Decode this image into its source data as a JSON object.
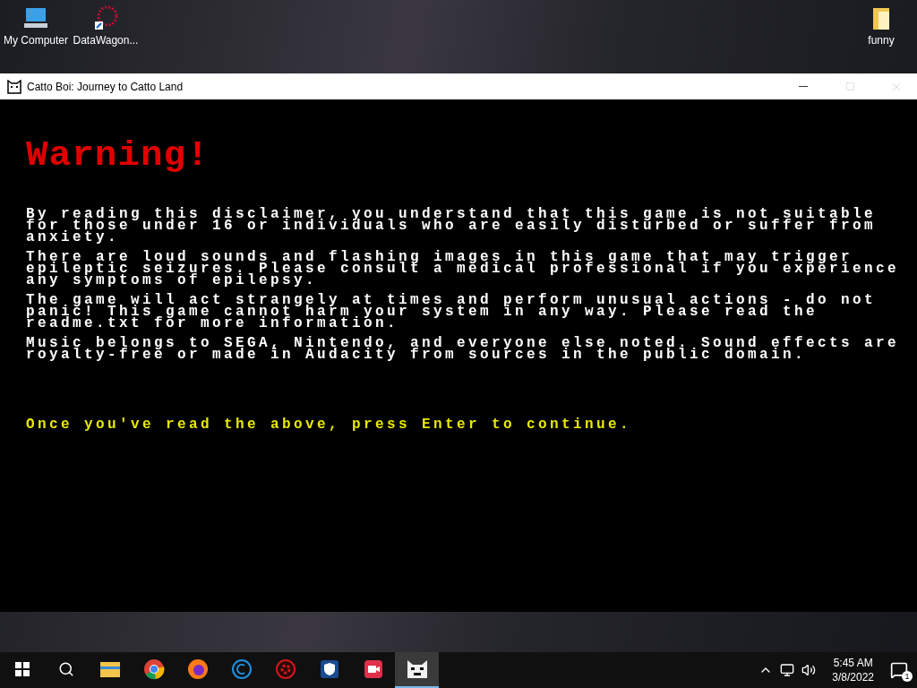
{
  "desktop_icons": [
    {
      "kind": "computer",
      "label": "My Computer"
    },
    {
      "kind": "shortcut",
      "label": "DataWagon..."
    },
    {
      "kind": "folder",
      "label": "funny"
    }
  ],
  "window": {
    "title": "Catto Boi: Journey to Catto Land"
  },
  "game": {
    "heading": "Warning!",
    "paragraphs": [
      "By reading this disclaimer, you understand that this game is not suitable for those under 16 or individuals who are easily disturbed or suffer from anxiety.",
      "There are loud sounds and flashing images in this game that may trigger epileptic seizures. Please consult a medical professional if you experience any symptoms of epilepsy.",
      "The game will act strangely at times and perform unusual actions - do not panic! This game cannot harm your system in any way. Please read the readme.txt for more information.",
      "Music belongs to SEGA, Nintendo, and everyone else noted. Sound effects are royalty-free or made in Audacity from sources in the public domain."
    ],
    "prompt": "Once you've read the above, press Enter to continue."
  },
  "taskbar": {
    "apps": [
      {
        "kind": "folder",
        "selected": false
      },
      {
        "kind": "chrome",
        "selected": false
      },
      {
        "kind": "firefox",
        "selected": false
      },
      {
        "kind": "c",
        "selected": false
      },
      {
        "kind": "gear",
        "selected": false
      },
      {
        "kind": "shield",
        "selected": false
      },
      {
        "kind": "camera",
        "selected": false
      },
      {
        "kind": "cat",
        "selected": true
      }
    ],
    "time": "5:45 AM",
    "date": "3/8/2022",
    "notifications": "1"
  }
}
